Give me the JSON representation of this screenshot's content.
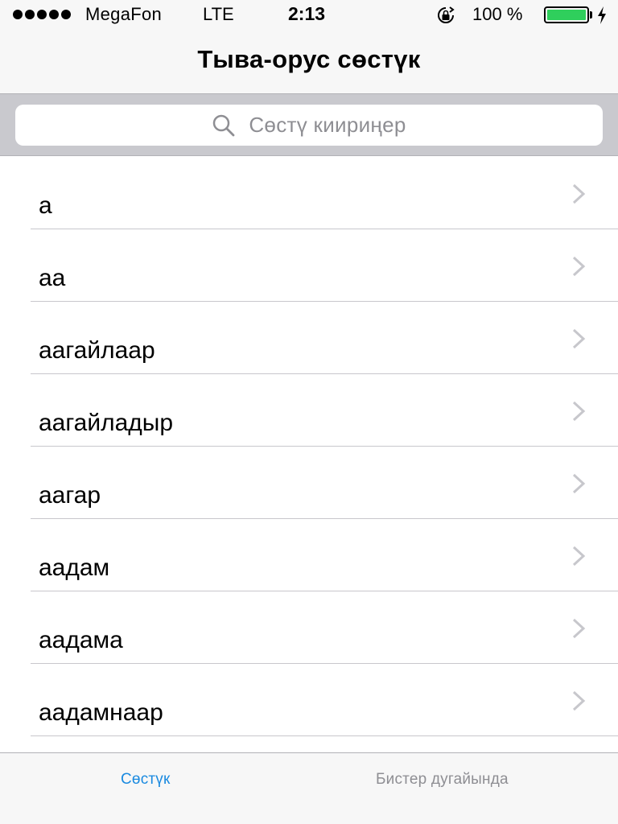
{
  "status_bar": {
    "carrier": "MegaFon",
    "network": "LTE",
    "time": "2:13",
    "battery_percent": "100 %",
    "battery_level": 1.0,
    "battery_color": "#2fcf5c"
  },
  "nav": {
    "title": "Тыва-орус сөстүк"
  },
  "search": {
    "placeholder": "Сөстү киириңер"
  },
  "list": {
    "items": [
      {
        "label": "а"
      },
      {
        "label": "аа"
      },
      {
        "label": "аагайлаар"
      },
      {
        "label": "аагайладыр"
      },
      {
        "label": "аагар"
      },
      {
        "label": "аадам"
      },
      {
        "label": "аадама"
      },
      {
        "label": "аадамнаар"
      }
    ]
  },
  "tab_bar": {
    "tabs": [
      {
        "label": "Сөстүк",
        "active": true
      },
      {
        "label": "Бистер дугайында",
        "active": false
      }
    ],
    "active_color": "#1a8ae0",
    "inactive_color": "#8e8e93"
  }
}
